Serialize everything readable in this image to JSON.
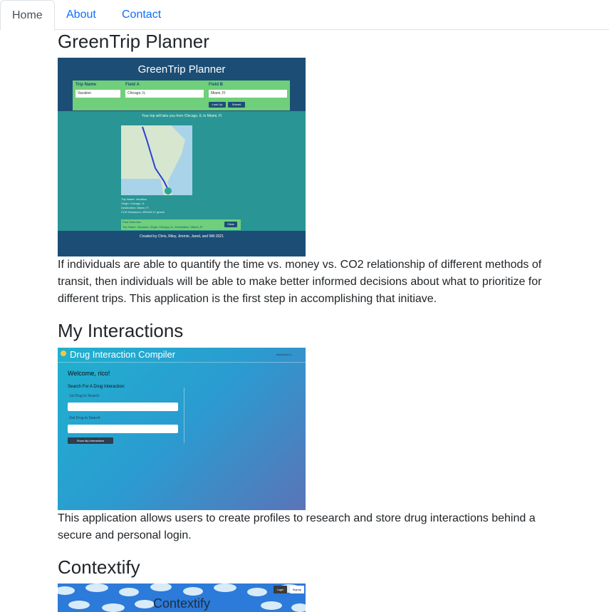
{
  "nav": {
    "tabs": [
      {
        "label": "Home",
        "active": true
      },
      {
        "label": "About",
        "active": false
      },
      {
        "label": "Contact",
        "active": false
      }
    ]
  },
  "projects": [
    {
      "title": "GreenTrip Planner",
      "description": "If individuals are able to quantify the time vs. money vs. CO2 relationship of different methods of transit, then individuals will be able to make better informed decisions about what to prioritize for different trips. This application is the first step in accomplishing that initiave.",
      "screenshot": {
        "app_title": "GreenTrip Planner",
        "trip_name_label": "Trip Name",
        "trip_name_value": "Vacation",
        "field_a_label": "Field A",
        "field_a_value": "Chicago, IL",
        "field_b_label": "Field B",
        "field_b_value": "Miami, FI",
        "lookup_label": "Look Up",
        "submit_label": "Submit",
        "message": "Your trip will take you from Chicago, IL to Miami, Fl",
        "info_lines": [
          "Trip Name: Vacation",
          "Origin: Chicago, IL",
          "Destination: Miami, Fl",
          "CO2 Emissions: 499449.37 grams"
        ],
        "past_searches_label": "Past Searches",
        "past_searches_value": "Trip Name: Vacation, Origin: Chicago, IL, Destination: Miami, FI",
        "clear_label": "Clear",
        "footer": "Created by Chris, Riley, Jimmie, Jared, and Will 2021"
      }
    },
    {
      "title": "My Interactions",
      "description": "This application allows users to create profiles to research and store drug interactions behind a secure and personal login.",
      "screenshot": {
        "app_title": "Drug Interaction Compiler",
        "dashboard_label": "dashboard |",
        "welcome": "Welcome, rico!",
        "search_heading": "Search For A Drug Interaction:",
        "first_drug_label": "1st Drug to Search:",
        "second_drug_label": "2nd Drug to Search:",
        "button_label": "Show My Interactions"
      }
    },
    {
      "title": "Contextify",
      "screenshot": {
        "app_title": "Contextify",
        "login_label": "Login",
        "signup_label": "Signup"
      }
    }
  ]
}
